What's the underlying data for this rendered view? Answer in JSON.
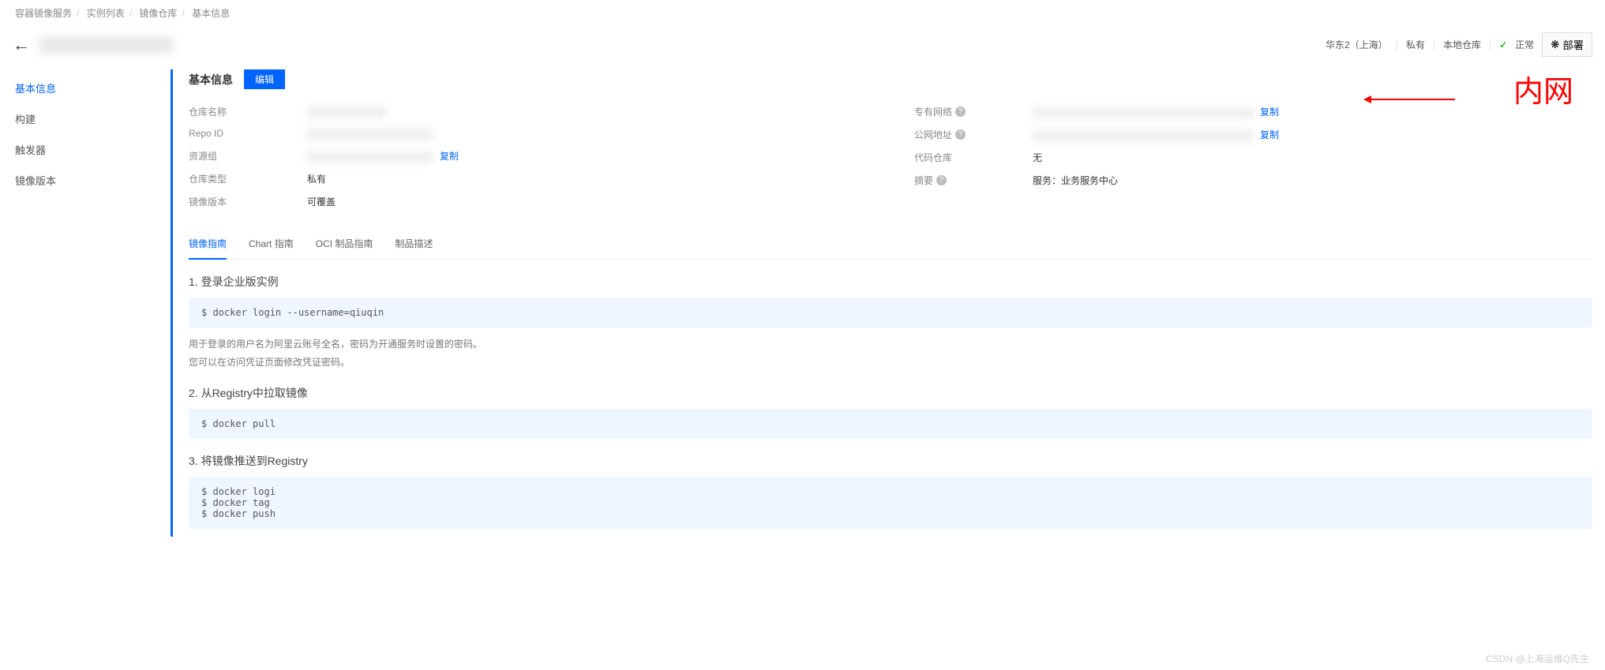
{
  "breadcrumb": [
    "容器镜像服务",
    "实例列表",
    "镜像仓库",
    "基本信息"
  ],
  "headerRight": {
    "region": "华东2（上海）",
    "access": "私有",
    "repoLoc": "本地仓库",
    "status": "正常",
    "deploy": "部署"
  },
  "sidebar": [
    "基本信息",
    "构建",
    "触发器",
    "镜像版本"
  ],
  "section": {
    "title": "基本信息",
    "edit": "编辑"
  },
  "infoLeft": {
    "name_l": "仓库名称",
    "repoid_l": "Repo ID",
    "resgrp_l": "资源组",
    "resgrp_copy": "复制",
    "type_l": "仓库类型",
    "type_v": "私有",
    "ver_l": "镜像版本",
    "ver_v": "可覆盖"
  },
  "infoRight": {
    "vpc_l": "专有网络",
    "vpc_copy": "复制",
    "pub_l": "公网地址",
    "pub_copy": "复制",
    "code_l": "代码仓库",
    "code_v": "无",
    "summary_l": "摘要",
    "summary_v": "服务：业务服务中心"
  },
  "tabs": [
    "镜像指南",
    "Chart 指南",
    "OCI 制品指南",
    "制品描述"
  ],
  "guide": {
    "h1": "1. 登录企业版实例",
    "c1": "$ docker login --username=qiuqin",
    "n1": "用于登录的用户名为阿里云账号全名，密码为开通服务时设置的密码。",
    "n2": "您可以在访问凭证页面修改凭证密码。",
    "h2": "2. 从Registry中拉取镜像",
    "c2": "$ docker pull",
    "h3": "3. 将镜像推送到Registry",
    "c3": "$ docker logi\n$ docker tag\n$ docker push"
  },
  "annotation": "内网",
  "watermark": "CSDN @上海运维Q先生"
}
